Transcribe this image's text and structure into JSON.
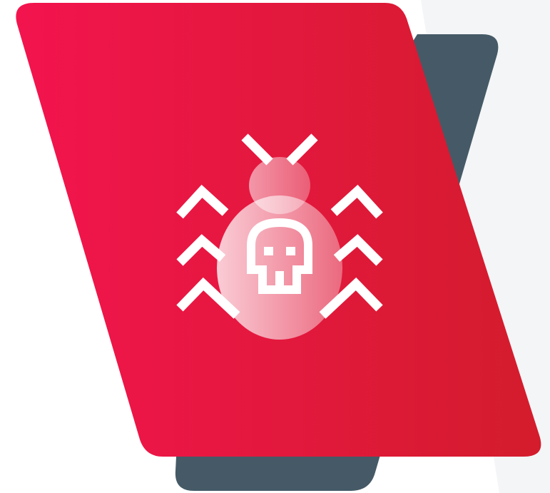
{
  "illustration": {
    "icon": "bug-skull-icon",
    "colors": {
      "background": "#ffffff",
      "light_accent": "#f3f4f6",
      "back_panel": "#455a66",
      "front_panel_start": "#f3144e",
      "front_panel_end": "#d31c2c",
      "icon_stroke": "#ffffff"
    }
  }
}
